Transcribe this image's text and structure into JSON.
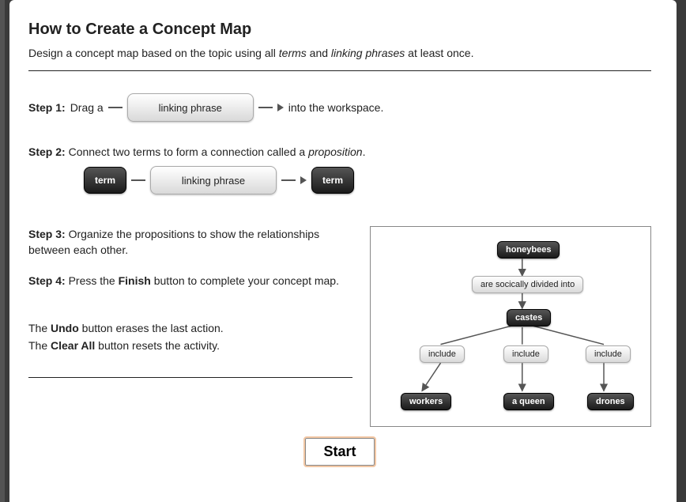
{
  "title": "How to Create a Concept Map",
  "intro": {
    "prefix": "Design a concept map based on the topic using all ",
    "terms": "terms",
    "mid": " and ",
    "linking": "linking phrases",
    "suffix": " at least once."
  },
  "step1": {
    "label": "Step 1:",
    "pre": "Drag a",
    "token": "linking phrase",
    "post": "into the workspace."
  },
  "step2": {
    "label": "Step 2:",
    "text_pre": "Connect two terms to form a connection called a ",
    "em": "proposition",
    "text_post": ".",
    "term_a": "term",
    "linking": "linking phrase",
    "term_b": "term"
  },
  "step3": {
    "label": "Step 3:",
    "text": " Organize the propositions to show the relationships between each other."
  },
  "step4": {
    "label": "Step 4:",
    "pre": " Press the ",
    "bold": "Finish",
    "post": " button to complete your concept map."
  },
  "undo": {
    "pre": "The ",
    "bold": "Undo",
    "post": " button erases the last action."
  },
  "clear": {
    "pre": "The ",
    "bold": "Clear All",
    "post": " button resets the activity."
  },
  "diagram": {
    "honeybees": "honeybees",
    "divided": "are socically divided into",
    "castes": "castes",
    "include1": "include",
    "include2": "include",
    "include3": "include",
    "workers": "workers",
    "queen": "a queen",
    "drones": "drones"
  },
  "start": "Start"
}
